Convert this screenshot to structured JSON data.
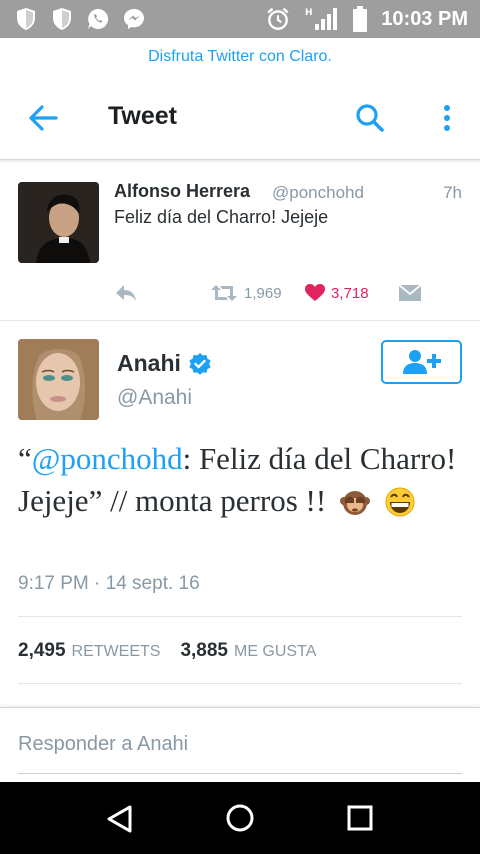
{
  "status_bar": {
    "time": "10:03 PM",
    "left_icons": [
      "shield-icon",
      "shield-icon",
      "whatsapp-icon",
      "messenger-icon"
    ],
    "right_icons": [
      "alarm-icon",
      "signal-icon",
      "battery-icon"
    ]
  },
  "promo": {
    "text": "Disfruta Twitter con Claro."
  },
  "toolbar": {
    "title": "Tweet",
    "back_icon": "arrow-left-icon",
    "search_icon": "search-icon",
    "more_icon": "more-vertical-icon"
  },
  "in_reply_to": {
    "name": "Alfonso Herrera",
    "handle": "@ponchohd",
    "time": "7h",
    "text": "Feliz día del Charro! Jejeje",
    "retweets": "1,969",
    "likes": "3,718"
  },
  "tweet": {
    "name": "Anahi",
    "handle": "@Anahi",
    "verified": true,
    "text_open": "“",
    "mention": "@ponchohd",
    "text_body": ": Feliz día del Charro! Jejeje” // monta perros !!",
    "emojis": [
      "see-no-evil-monkey-emoji",
      "grinning-face-emoji"
    ],
    "timestamp": "9:17 PM · 14 sept. 16",
    "retweet_count": "2,495",
    "retweet_label": "RETWEETS",
    "like_count": "3,885",
    "like_label": "ME GUSTA"
  },
  "reply": {
    "placeholder": "Responder a Anahi"
  },
  "colors": {
    "accent": "#1da1f2",
    "like": "#e0245e",
    "muted": "#8899a6",
    "status_bar": "#9e9e9e"
  }
}
